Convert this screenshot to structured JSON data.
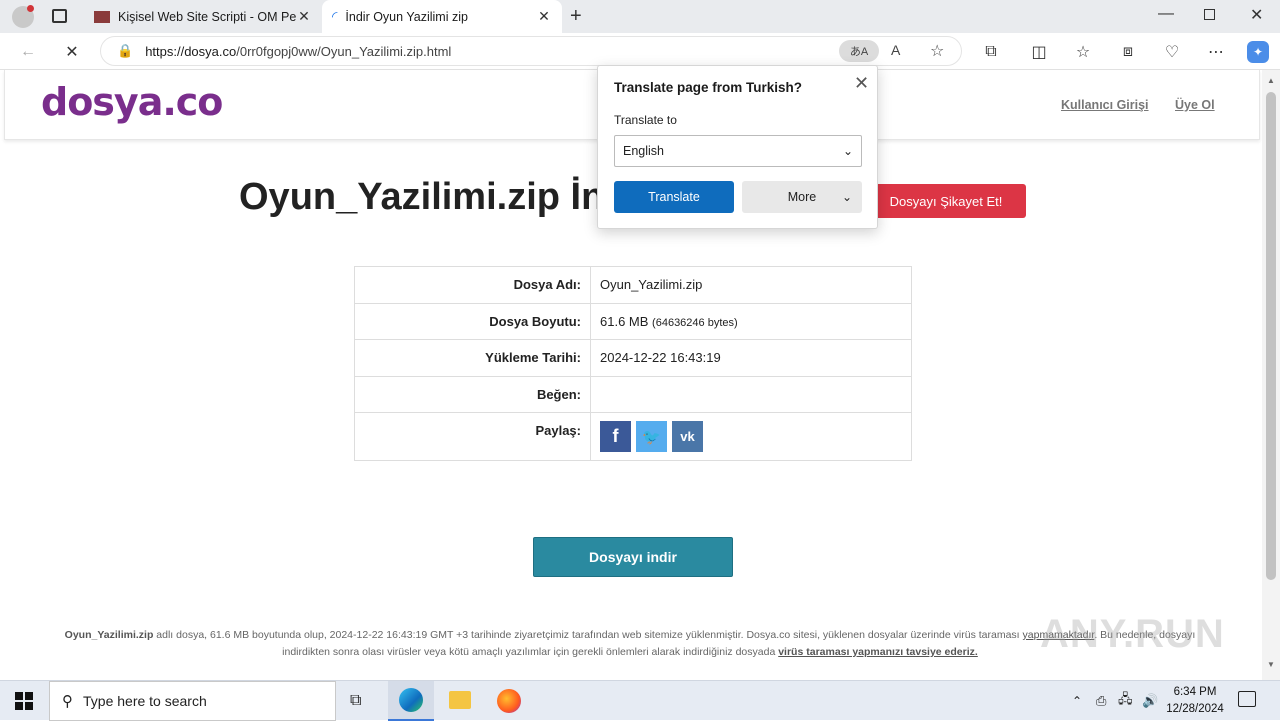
{
  "browser": {
    "tabs": [
      {
        "title": "Kişisel Web Site Scripti - OM Pers",
        "active": false
      },
      {
        "title": "İndir Oyun Yazilimi zip",
        "active": true
      }
    ],
    "url_host": "https://dosya.co",
    "url_path": "/0rr0fgopj0ww/Oyun_Yazilimi.zip.html",
    "translate_badge": "あA"
  },
  "site": {
    "logo": "dosya.co",
    "login_link": "Kullanıcı Girişi",
    "register_link": "Üye Ol",
    "page_title": "Oyun_Yazilimi.zip İn",
    "report_button": "Dosyayı Şikayet Et!",
    "table": [
      {
        "key": "Dosya Adı:",
        "value": "Oyun_Yazilimi.zip"
      },
      {
        "key": "Dosya Boyutu:",
        "value": "61.6 MB",
        "value_extra": "(64636246 bytes)"
      },
      {
        "key": "Yükleme Tarihi:",
        "value": "2024-12-22 16:43:19"
      },
      {
        "key": "Beğen:",
        "value": ""
      },
      {
        "key": "Paylaş:",
        "value": ""
      }
    ],
    "share_icons": [
      "facebook-icon",
      "twitter-icon",
      "vk-icon"
    ],
    "share_colors": {
      "facebook": "#3b5998",
      "twitter": "#55acee",
      "vk": "#4a76a8"
    },
    "download_button": "Dosyayı indir",
    "footer": {
      "filename": "Oyun_Yazilimi.zip",
      "text1": " adlı dosya, 61.6 MB boyutunda olup, 2024-12-22 16:43:19 GMT +3 tarihinde ziyaretçimiz tarafından web sitemize yüklenmiştir. Dosya.co sitesi, yüklenen dosyalar üzerinde virüs taraması ",
      "link1": "yapmamaktadır",
      "text2": ". Bu nedenle, dosyayı indirdikten sonra olası virüsler veya kötü amaçlı yazılımlar için gerekli önlemleri alarak indirdiğiniz dosyada ",
      "link2": "virüs taraması yapmanızı tavsiye ederiz."
    }
  },
  "translate_popup": {
    "title": "Translate page from Turkish?",
    "label": "Translate to",
    "selected_language": "English",
    "translate_button": "Translate",
    "more_button": "More"
  },
  "watermark": "ANY.RUN",
  "taskbar": {
    "search_placeholder": "Type here to search",
    "time": "6:34 PM",
    "date": "12/28/2024"
  }
}
